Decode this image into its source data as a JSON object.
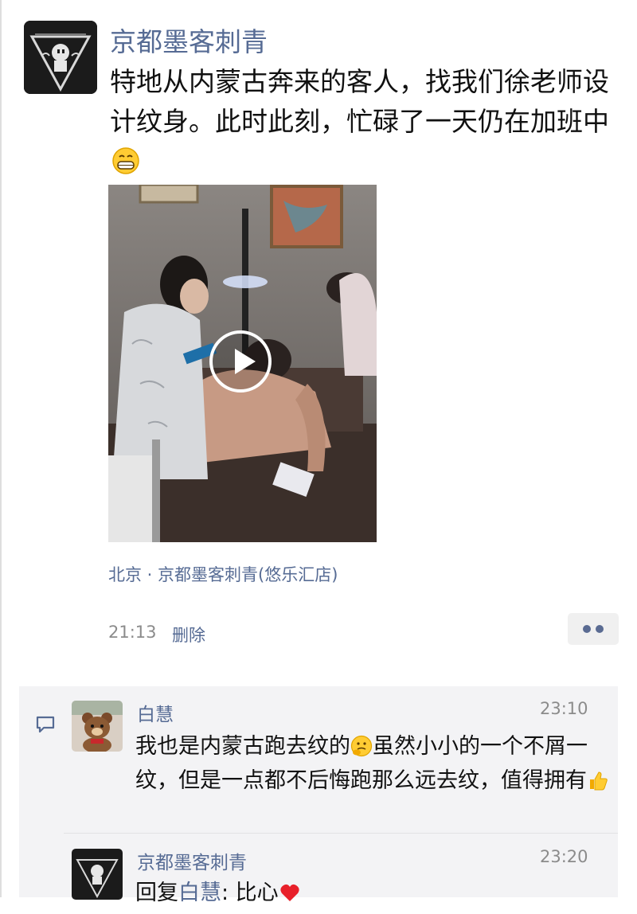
{
  "post": {
    "author": "京都墨客刺青",
    "text": "特地从内蒙古奔来的客人，找我们徐老师设计纹身。此时此刻，忙碌了一天仍在加班中",
    "location": "北京 · 京都墨客刺青(悠乐汇店)",
    "time": "21:13",
    "delete_label": "删除"
  },
  "comments": [
    {
      "author": "白慧",
      "time": "23:10",
      "text_part1": "我也是内蒙古跑去纹的",
      "text_part2": "虽然小小的一个不屑一纹，但是一点都不后悔跑那么远去纹，值得拥有"
    },
    {
      "author": "京都墨客刺青",
      "time": "23:20",
      "reply_prefix": "回复",
      "reply_to": "白慧",
      "reply_text": ": 比心"
    }
  ],
  "icons": {
    "emoji_1": "grinning-face-emoji",
    "emoji_2": "thinking-face-emoji",
    "emoji_3": "thumbs-up-emoji",
    "emoji_4": "heart-emoji",
    "comment": "comment-bubble-icon",
    "more": "more-dots-icon",
    "play": "play-icon"
  },
  "colors": {
    "link": "#566b94",
    "muted": "#8b8b8b",
    "comment_bg": "#f3f3f5"
  }
}
